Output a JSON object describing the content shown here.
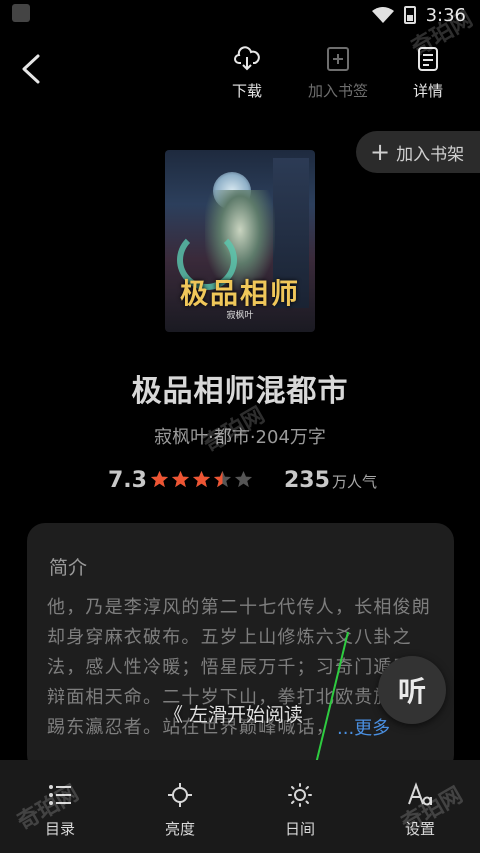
{
  "status_bar": {
    "time": "3:36"
  },
  "top_nav": {
    "download_label": "下载",
    "bookmark_label": "加入书签",
    "details_label": "详情"
  },
  "shelf": {
    "label": "加入书架"
  },
  "cover": {
    "logo_text": "极品相师",
    "author_mark": "寂枫叶"
  },
  "book": {
    "title": "极品相师混都市",
    "meta": "寂枫叶·都市·204万字",
    "score": "7.3",
    "stars_rating": 3.5,
    "stars_max": 5,
    "popularity_value": "235",
    "popularity_unit": "万人气"
  },
  "intro": {
    "heading": "简介",
    "text": "他，乃是李淳风的第二十七代传人，长相俊朗却身穿麻衣破布。五岁上山修炼六爻八卦之法，感人性冷暖；悟星辰万千；习奇门遁甲，辩面相天命。二十岁下山，拳打北欧贵族，脚踢东瀛忍者。站在世界巅峰喊话，",
    "more_label": "...更多"
  },
  "swipe_hint": "《 左滑开始阅读",
  "listen_label": "听",
  "bottom_bar": {
    "toc_label": "目录",
    "brightness_label": "亮度",
    "day_label": "日间",
    "settings_label": "设置"
  },
  "watermark_text": "奇珀网",
  "colors": {
    "accent_link": "#4a8fe0",
    "star_fill": "#ee5533",
    "star_empty": "#555555",
    "annotation_arrow": "#2ecc40"
  }
}
